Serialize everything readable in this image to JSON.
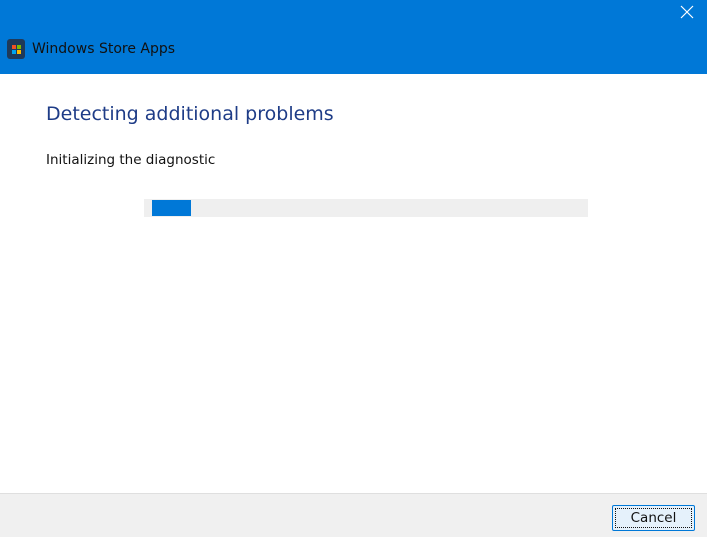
{
  "window": {
    "title": "Windows Store Apps",
    "accent": "#0078d7"
  },
  "main": {
    "heading": "Detecting additional problems",
    "status": "Initializing the diagnostic",
    "progress": {
      "mode": "indeterminate",
      "segment_fraction": 0.09
    }
  },
  "footer": {
    "cancel_label": "Cancel"
  }
}
